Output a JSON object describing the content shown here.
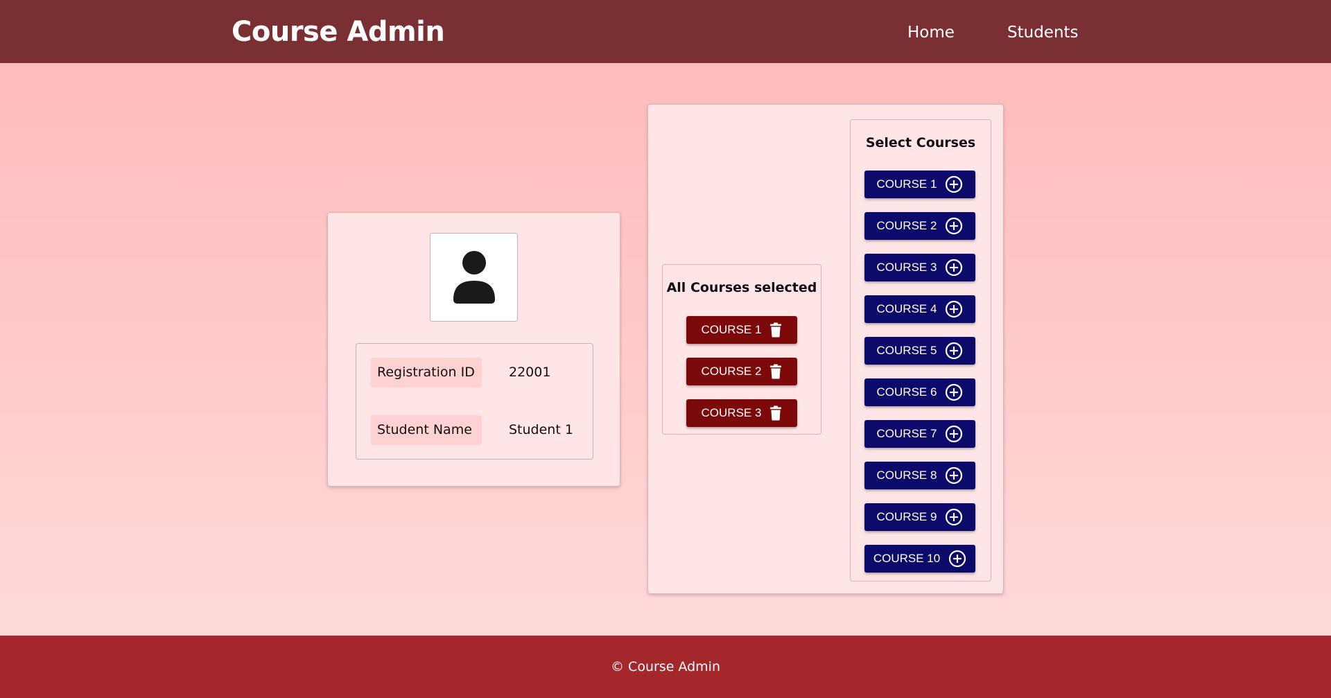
{
  "header": {
    "brand": "Course Admin",
    "nav": [
      "Home",
      "Students"
    ]
  },
  "profile": {
    "avatar_icon": "person-icon",
    "fields": [
      {
        "label": "Registration ID",
        "value": "22001"
      },
      {
        "label": "Student Name",
        "value": "Student 1"
      }
    ]
  },
  "selected_courses": {
    "title": "All Courses selected",
    "remove_icon": "trash-icon",
    "items": [
      "COURSE 1",
      "COURSE 2",
      "COURSE 3"
    ]
  },
  "available_courses": {
    "title": "Select Courses",
    "add_icon": "plus-circle-icon",
    "items": [
      "COURSE 1",
      "COURSE 2",
      "COURSE 3",
      "COURSE 4",
      "COURSE 5",
      "COURSE 6",
      "COURSE 7",
      "COURSE 8",
      "COURSE 9",
      "COURSE 10"
    ]
  },
  "footer": {
    "text": "© Course Admin"
  },
  "colors": {
    "navbar": "#7a2f33",
    "footer": "#a4282b",
    "remove_button": "#7d0a0a",
    "add_button": "#0c0a6a",
    "card": "#ffe5e5"
  }
}
